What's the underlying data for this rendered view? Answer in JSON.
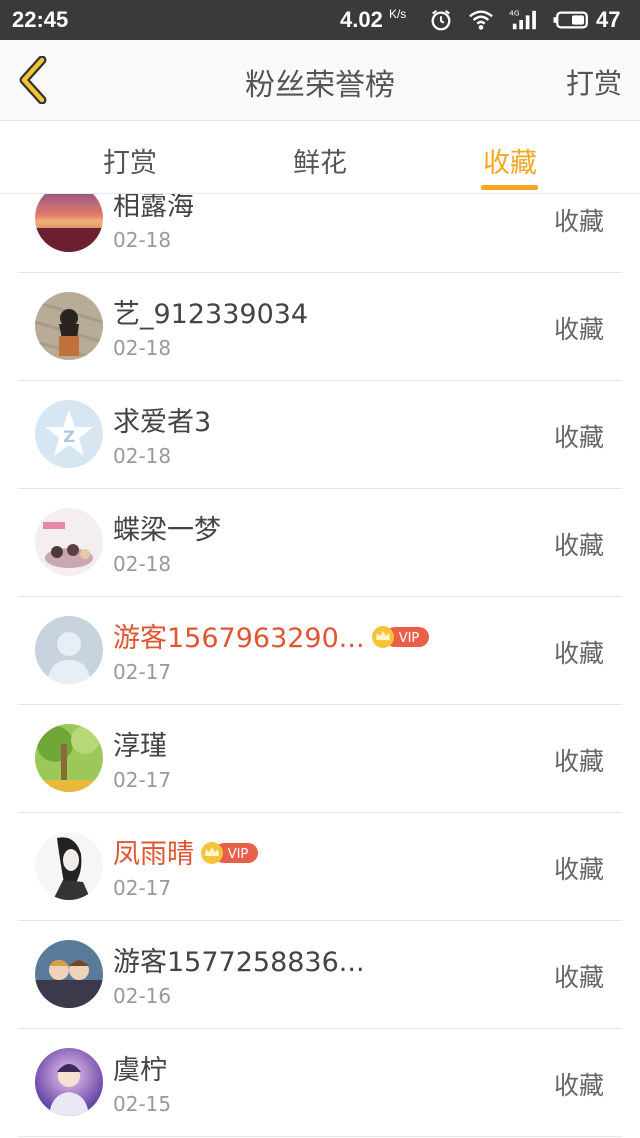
{
  "status_bar": {
    "time": "22:45",
    "speed_value": "4.02",
    "speed_unit": "K/s",
    "network": "4G",
    "battery": "47",
    "icons": [
      "alarm-icon",
      "wifi-icon",
      "signal-icon",
      "battery-icon"
    ]
  },
  "header": {
    "title": "粉丝荣誉榜",
    "right_action": "打赏",
    "back_icon": "chevron-left-icon"
  },
  "tabs": [
    {
      "label": "打赏",
      "active": false
    },
    {
      "label": "鲜花",
      "active": false
    },
    {
      "label": "收藏",
      "active": true
    }
  ],
  "colors": {
    "accent": "#f5a623",
    "vip_name": "#e05533",
    "vip_badge": "#e8604a"
  },
  "list": [
    {
      "name": "相露海",
      "date": "02-18",
      "action": "收藏",
      "vip": false,
      "avatar": "sunset-avatar"
    },
    {
      "name": "艺_912339034",
      "date": "02-18",
      "action": "收藏",
      "vip": false,
      "avatar": "girl-avatar"
    },
    {
      "name": "求爱者3",
      "date": "02-18",
      "action": "收藏",
      "vip": false,
      "avatar": "qq-star-avatar"
    },
    {
      "name": "蝶梁一梦",
      "date": "02-18",
      "action": "收藏",
      "vip": false,
      "avatar": "drama-avatar"
    },
    {
      "name": "游客1567963290...",
      "date": "02-17",
      "action": "收藏",
      "vip": true,
      "vip_label": "VIP",
      "avatar": "default-person-avatar"
    },
    {
      "name": "淳瑾",
      "date": "02-17",
      "action": "收藏",
      "vip": false,
      "avatar": "tree-avatar"
    },
    {
      "name": "凤雨晴",
      "date": "02-17",
      "action": "收藏",
      "vip": true,
      "vip_label": "VIP",
      "avatar": "ink-drawing-avatar"
    },
    {
      "name": "游客1577258836...",
      "date": "02-16",
      "action": "收藏",
      "vip": false,
      "avatar": "couple-avatar"
    },
    {
      "name": "虞柠",
      "date": "02-15",
      "action": "收藏",
      "vip": false,
      "avatar": "boy-avatar"
    }
  ]
}
